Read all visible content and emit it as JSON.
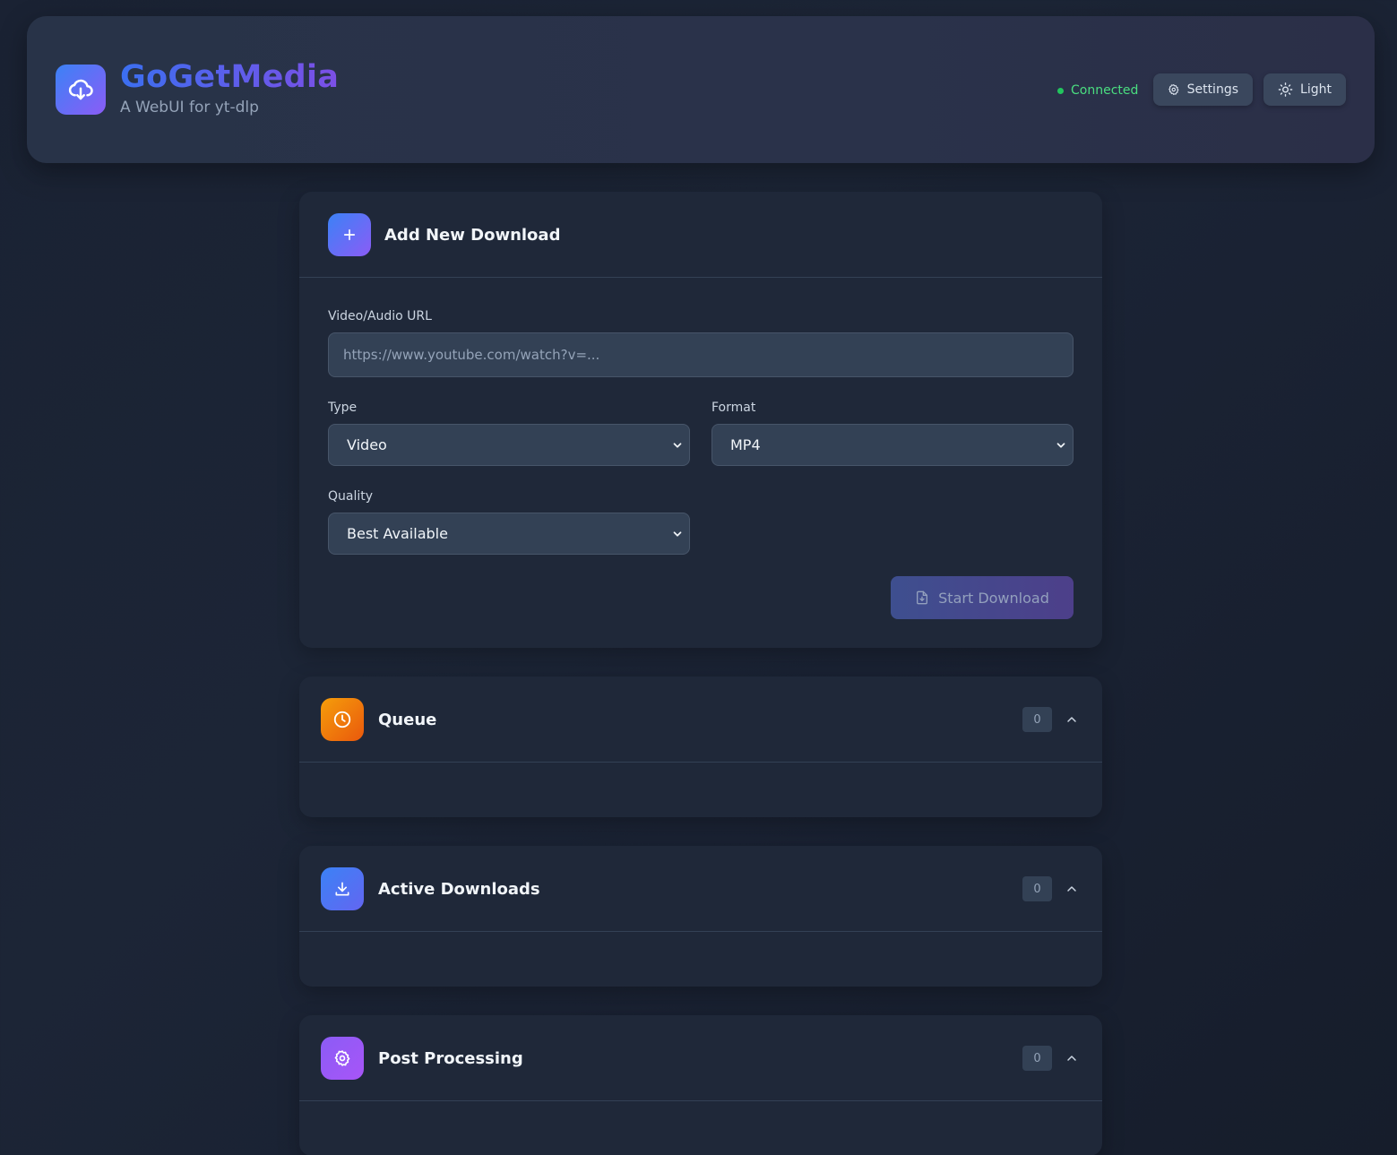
{
  "header": {
    "title": "GoGetMedia",
    "subtitle": "A WebUI for yt-dlp",
    "status": "Connected",
    "settings_label": "Settings",
    "theme_label": "Light"
  },
  "add_download": {
    "title": "Add New Download",
    "url_label": "Video/Audio URL",
    "url_placeholder": "https://www.youtube.com/watch?v=...",
    "type_label": "Type",
    "type_value": "Video",
    "format_label": "Format",
    "format_value": "MP4",
    "quality_label": "Quality",
    "quality_value": "Best Available",
    "start_label": "Start Download"
  },
  "sections": [
    {
      "title": "Queue",
      "count": "0",
      "icon": "clock-icon",
      "color_from": "#f59e0b",
      "color_to": "#ea580c"
    },
    {
      "title": "Active Downloads",
      "count": "0",
      "icon": "download-icon",
      "color_from": "#3b82f6",
      "color_to": "#6366f1"
    },
    {
      "title": "Post Processing",
      "count": "0",
      "icon": "gear-icon",
      "color_from": "#8b5cf6",
      "color_to": "#a855f7"
    }
  ],
  "colors": {
    "accent_blue": "#3b82f6",
    "accent_purple": "#8b5cf6",
    "status_green": "#22c55e"
  }
}
